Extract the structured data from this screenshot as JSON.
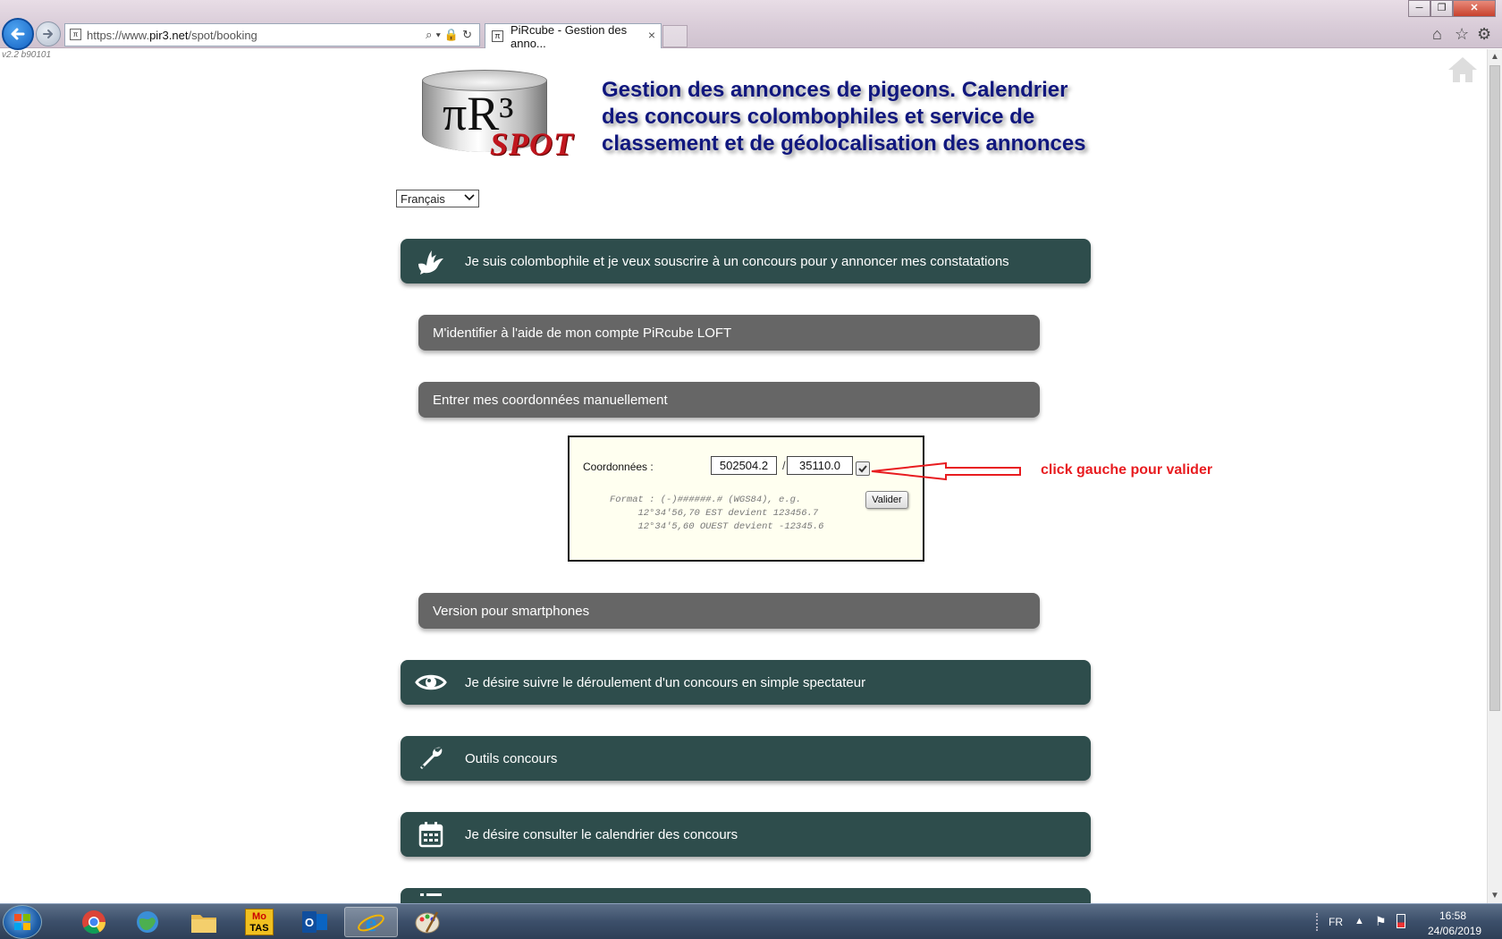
{
  "browser": {
    "url_prefix": "https://www.",
    "url_domain": "pir3.net",
    "url_path": "/spot/booking",
    "tab_title": "PiRcube - Gestion des anno...",
    "tab_close": "×",
    "win_min": "─",
    "win_max": "❐",
    "win_close": "✕",
    "addr_icons": "⌕▾🔒↻"
  },
  "page": {
    "version": "v2.2 b90101",
    "logo_pi": "πR³",
    "logo_spot": "SPOT",
    "title": "Gestion des annonces de pigeons. Calendrier des concours colombophiles et service de classement et de géolocalisation des annonces",
    "language": "Français",
    "bars": {
      "colombophile": "Je suis colombophile et je veux souscrire à un concours pour y annoncer mes constatations",
      "spectateur": "Je désire suivre le déroulement d'un concours en simple spectateur",
      "outils": "Outils concours",
      "calendrier": "Je désire consulter le calendrier des concours"
    },
    "sub_bars": {
      "login": "M'identifier à l'aide de mon compte PiRcube LOFT",
      "manual": "Entrer mes coordonnées manuellement",
      "smartphone": "Version pour smartphones"
    },
    "coords": {
      "label": "Coordonnées :",
      "latitude": "502504.2",
      "separator": "/",
      "longitude": "35110.0",
      "valider": "Valider",
      "format_help": "Format : (-)######.# (WGS84), e.g.\n     12°34'56,70 EST devient 123456.7\n     12°34'5,60 OUEST devient -12345.6"
    },
    "annotation": "click gauche pour valider"
  },
  "taskbar": {
    "lang": "FR",
    "time": "16:58",
    "date": "24/06/2019",
    "mo_tas_line1": "Mo",
    "mo_tas_line2": "TAS"
  },
  "colors": {
    "bar_dark": "#2e4d4c",
    "bar_grey": "#666666",
    "title_blue": "#10177e",
    "annotation_red": "#e81c20",
    "spot_red": "#c0161e"
  }
}
